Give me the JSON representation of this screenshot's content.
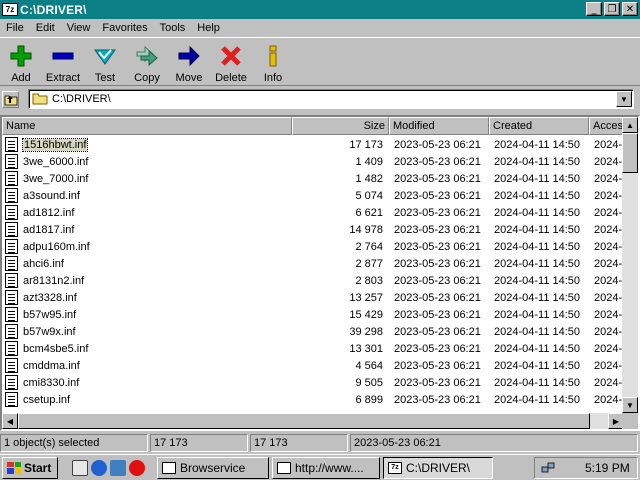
{
  "window": {
    "title": "C:\\DRIVER\\",
    "app_icon": "7z"
  },
  "menu": [
    "File",
    "Edit",
    "View",
    "Favorites",
    "Tools",
    "Help"
  ],
  "toolbar": [
    {
      "label": "Add",
      "icon": "plus-icon",
      "color": "#00a000"
    },
    {
      "label": "Extract",
      "icon": "minus-icon",
      "color": "#0000c0"
    },
    {
      "label": "Test",
      "icon": "check-icon",
      "color": "#00b0c0"
    },
    {
      "label": "Copy",
      "icon": "double-arrow-icon",
      "color": "#40a080"
    },
    {
      "label": "Move",
      "icon": "arrow-right-icon",
      "color": "#0000a0"
    },
    {
      "label": "Delete",
      "icon": "x-icon",
      "color": "#e02020"
    },
    {
      "label": "Info",
      "icon": "info-icon",
      "color": "#c0a000"
    }
  ],
  "address": {
    "path": "C:\\DRIVER\\"
  },
  "columns": [
    "Name",
    "Size",
    "Modified",
    "Created",
    "Acces"
  ],
  "files": [
    {
      "name": "1516hbwt.inf",
      "size": "17 173",
      "modified": "2023-05-23 06:21",
      "created": "2024-04-11 14:50",
      "accessed": "2024-",
      "selected": true
    },
    {
      "name": "3we_6000.inf",
      "size": "1 409",
      "modified": "2023-05-23 06:21",
      "created": "2024-04-11 14:50",
      "accessed": "2024-"
    },
    {
      "name": "3we_7000.inf",
      "size": "1 482",
      "modified": "2023-05-23 06:21",
      "created": "2024-04-11 14:50",
      "accessed": "2024-"
    },
    {
      "name": "a3sound.inf",
      "size": "5 074",
      "modified": "2023-05-23 06:21",
      "created": "2024-04-11 14:50",
      "accessed": "2024-"
    },
    {
      "name": "ad1812.inf",
      "size": "6 621",
      "modified": "2023-05-23 06:21",
      "created": "2024-04-11 14:50",
      "accessed": "2024-"
    },
    {
      "name": "ad1817.inf",
      "size": "14 978",
      "modified": "2023-05-23 06:21",
      "created": "2024-04-11 14:50",
      "accessed": "2024-"
    },
    {
      "name": "adpu160m.inf",
      "size": "2 764",
      "modified": "2023-05-23 06:21",
      "created": "2024-04-11 14:50",
      "accessed": "2024-"
    },
    {
      "name": "ahci6.inf",
      "size": "2 877",
      "modified": "2023-05-23 06:21",
      "created": "2024-04-11 14:50",
      "accessed": "2024-"
    },
    {
      "name": "ar8131n2.inf",
      "size": "2 803",
      "modified": "2023-05-23 06:21",
      "created": "2024-04-11 14:50",
      "accessed": "2024-"
    },
    {
      "name": "azt3328.inf",
      "size": "13 257",
      "modified": "2023-05-23 06:21",
      "created": "2024-04-11 14:50",
      "accessed": "2024-"
    },
    {
      "name": "b57w95.inf",
      "size": "15 429",
      "modified": "2023-05-23 06:21",
      "created": "2024-04-11 14:50",
      "accessed": "2024-"
    },
    {
      "name": "b57w9x.inf",
      "size": "39 298",
      "modified": "2023-05-23 06:21",
      "created": "2024-04-11 14:50",
      "accessed": "2024-"
    },
    {
      "name": "bcm4sbe5.inf",
      "size": "13 301",
      "modified": "2023-05-23 06:21",
      "created": "2024-04-11 14:50",
      "accessed": "2024-"
    },
    {
      "name": "cmddma.inf",
      "size": "4 564",
      "modified": "2023-05-23 06:21",
      "created": "2024-04-11 14:50",
      "accessed": "2024-"
    },
    {
      "name": "cmi8330.inf",
      "size": "9 505",
      "modified": "2023-05-23 06:21",
      "created": "2024-04-11 14:50",
      "accessed": "2024-"
    },
    {
      "name": "csetup.inf",
      "size": "6 899",
      "modified": "2023-05-23 06:21",
      "created": "2024-04-11 14:50",
      "accessed": "2024-"
    }
  ],
  "status": {
    "selection": "1 object(s) selected",
    "size": "17 173",
    "packed": "17 173",
    "modified": "2023-05-23 06:21"
  },
  "taskbar": {
    "start": "Start",
    "tasks": [
      {
        "label": "Browservice",
        "active": false
      },
      {
        "label": "http://www....",
        "active": false
      },
      {
        "label": "C:\\DRIVER\\",
        "active": true
      }
    ],
    "clock": "5:19 PM"
  }
}
